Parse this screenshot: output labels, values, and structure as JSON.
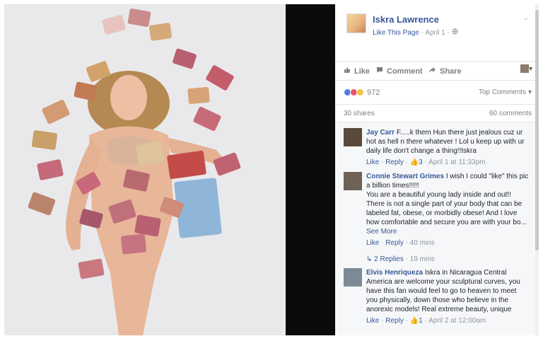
{
  "post": {
    "page_name": "Iskra Lawrence",
    "like_this_page": "Like This Page",
    "date": "April 1",
    "separator": "·",
    "globe_icon": "globe-icon"
  },
  "actions": {
    "like": "Like",
    "comment": "Comment",
    "share": "Share"
  },
  "stats": {
    "reaction_count": "972",
    "top_comments": "Top Comments",
    "shares": "30 shares",
    "comments": "60 comments"
  },
  "comments": [
    {
      "name": "Jay Carr",
      "text": "F.....k them Hun there just jealous cuz ur hot as hell n there whatever ! Lol u keep up with ur daily life don't change a thing!!Iskra",
      "like": "Like",
      "reply": "Reply",
      "likes": "3",
      "time": "April 1 at 11:33pm"
    },
    {
      "name": "Connie Stewart Grimes",
      "text": "I wish I could \"like\" this pic a billion times!!!!!",
      "text2": "You are a beautiful young lady inside and out!! There is not a single part of your body that can be labeled fat, obese, or morbidly obese! And I love how comfortable and secure you are with your bo...",
      "see_more": "See More",
      "like": "Like",
      "reply": "Reply",
      "time": "40 mins",
      "replies": "2 Replies",
      "replies_time": "19 mins"
    },
    {
      "name": "Elvis Henriqueza",
      "text": "Iskra in Nicaragua Central America are welcome your sculptural curves, you have this fan would feel to go to heaven to meet you physically, down those who believe in the anorexic models! Real extreme beauty, unique",
      "like": "Like",
      "reply": "Reply",
      "likes": "1",
      "time": "April 2 at 12:00am"
    }
  ],
  "colors": {
    "link": "#365899",
    "muted": "#90949c",
    "photo_bg": "#e9e9eb"
  }
}
